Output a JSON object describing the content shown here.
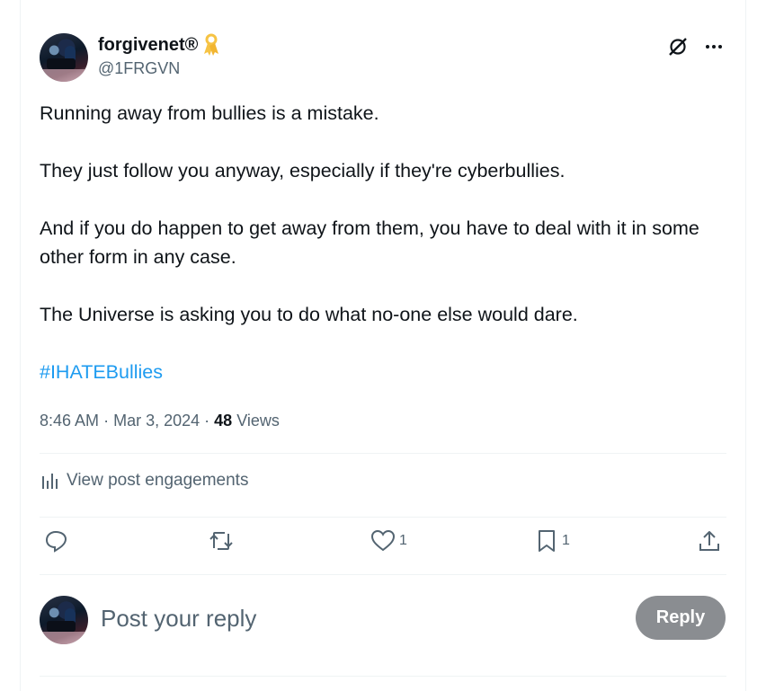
{
  "author": {
    "display_name": "forgivenet®",
    "handle": "@1FRGVN"
  },
  "post": {
    "paragraphs": [
      "Running away from bullies is a mistake.",
      "They just follow you anyway, especially if they're cyberbullies.",
      "And if you do happen to get away from them, you have to deal with it in some other form in any case.",
      "The Universe is asking you to do what no-one else would dare."
    ],
    "hashtag": "#IHATEBullies",
    "time": "8:46 AM",
    "date": "Mar 3, 2024",
    "sep": "·",
    "views_count": "48",
    "views_label": "Views"
  },
  "engagements_label": "View post engagements",
  "actions": {
    "likes": "1",
    "bookmarks": "1"
  },
  "reply": {
    "placeholder": "Post your reply",
    "button_label": "Reply"
  },
  "icons": [
    "grok-icon",
    "more-icon",
    "ribbon-icon",
    "analytics-icon",
    "reply-icon",
    "repost-icon",
    "like-icon",
    "bookmark-icon",
    "share-icon"
  ],
  "colors": {
    "link": "#1d9bf0",
    "secondary_text": "#536471",
    "reply_button_bg": "#8a8d91",
    "ribbon": "#f6c344"
  }
}
